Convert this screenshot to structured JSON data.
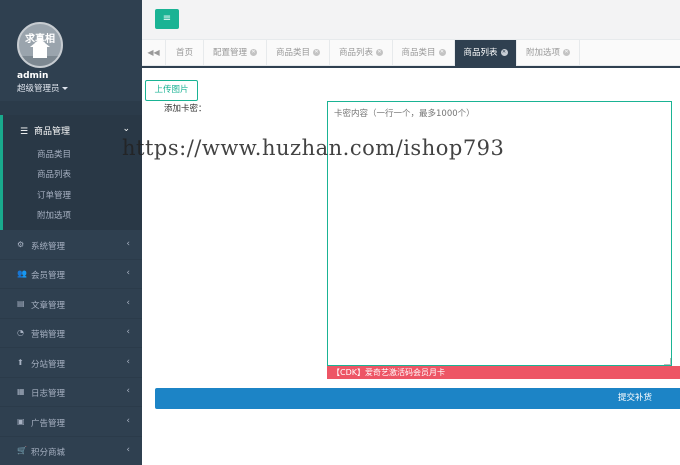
{
  "profile": {
    "avatar_text": "求真相",
    "username": "admin",
    "role": "超级管理员"
  },
  "sidebar": {
    "active_menu": {
      "icon": "list-icon",
      "label": "商品管理",
      "subitems": [
        "商品类目",
        "商品列表",
        "订单管理",
        "附加选项"
      ]
    },
    "items": [
      {
        "icon": "gear-icon",
        "label": "系统管理"
      },
      {
        "icon": "users-icon",
        "label": "会员管理"
      },
      {
        "icon": "document-icon",
        "label": "文章管理"
      },
      {
        "icon": "pie-chart-icon",
        "label": "营销管理"
      },
      {
        "icon": "upload-icon",
        "label": "分站管理"
      },
      {
        "icon": "log-icon",
        "label": "日志管理"
      },
      {
        "icon": "image-icon",
        "label": "广告管理"
      },
      {
        "icon": "cart-icon",
        "label": "积分商城"
      }
    ]
  },
  "tabs": [
    {
      "label": "首页",
      "closable": false
    },
    {
      "label": "配置管理",
      "closable": true
    },
    {
      "label": "商品类目",
      "closable": true
    },
    {
      "label": "商品列表",
      "closable": true
    },
    {
      "label": "商品类目",
      "closable": true
    },
    {
      "label": "商品列表",
      "closable": true,
      "active": true
    },
    {
      "label": "附加选项",
      "closable": true
    }
  ],
  "content": {
    "upload_label": "上传图片",
    "form_label": "添加卡密：",
    "textarea_placeholder": "卡密内容（一行一个，最多1000个）",
    "product_name": "【CDK】爱奇艺激活码会员月卡",
    "submit_label": "提交补货"
  },
  "watermark": "https://www.huzhan.com/ishop793",
  "colors": {
    "sidebar_bg": "#2f4050",
    "accent": "#1ab394",
    "danger": "#ed5565",
    "primary": "#1c84c6"
  }
}
